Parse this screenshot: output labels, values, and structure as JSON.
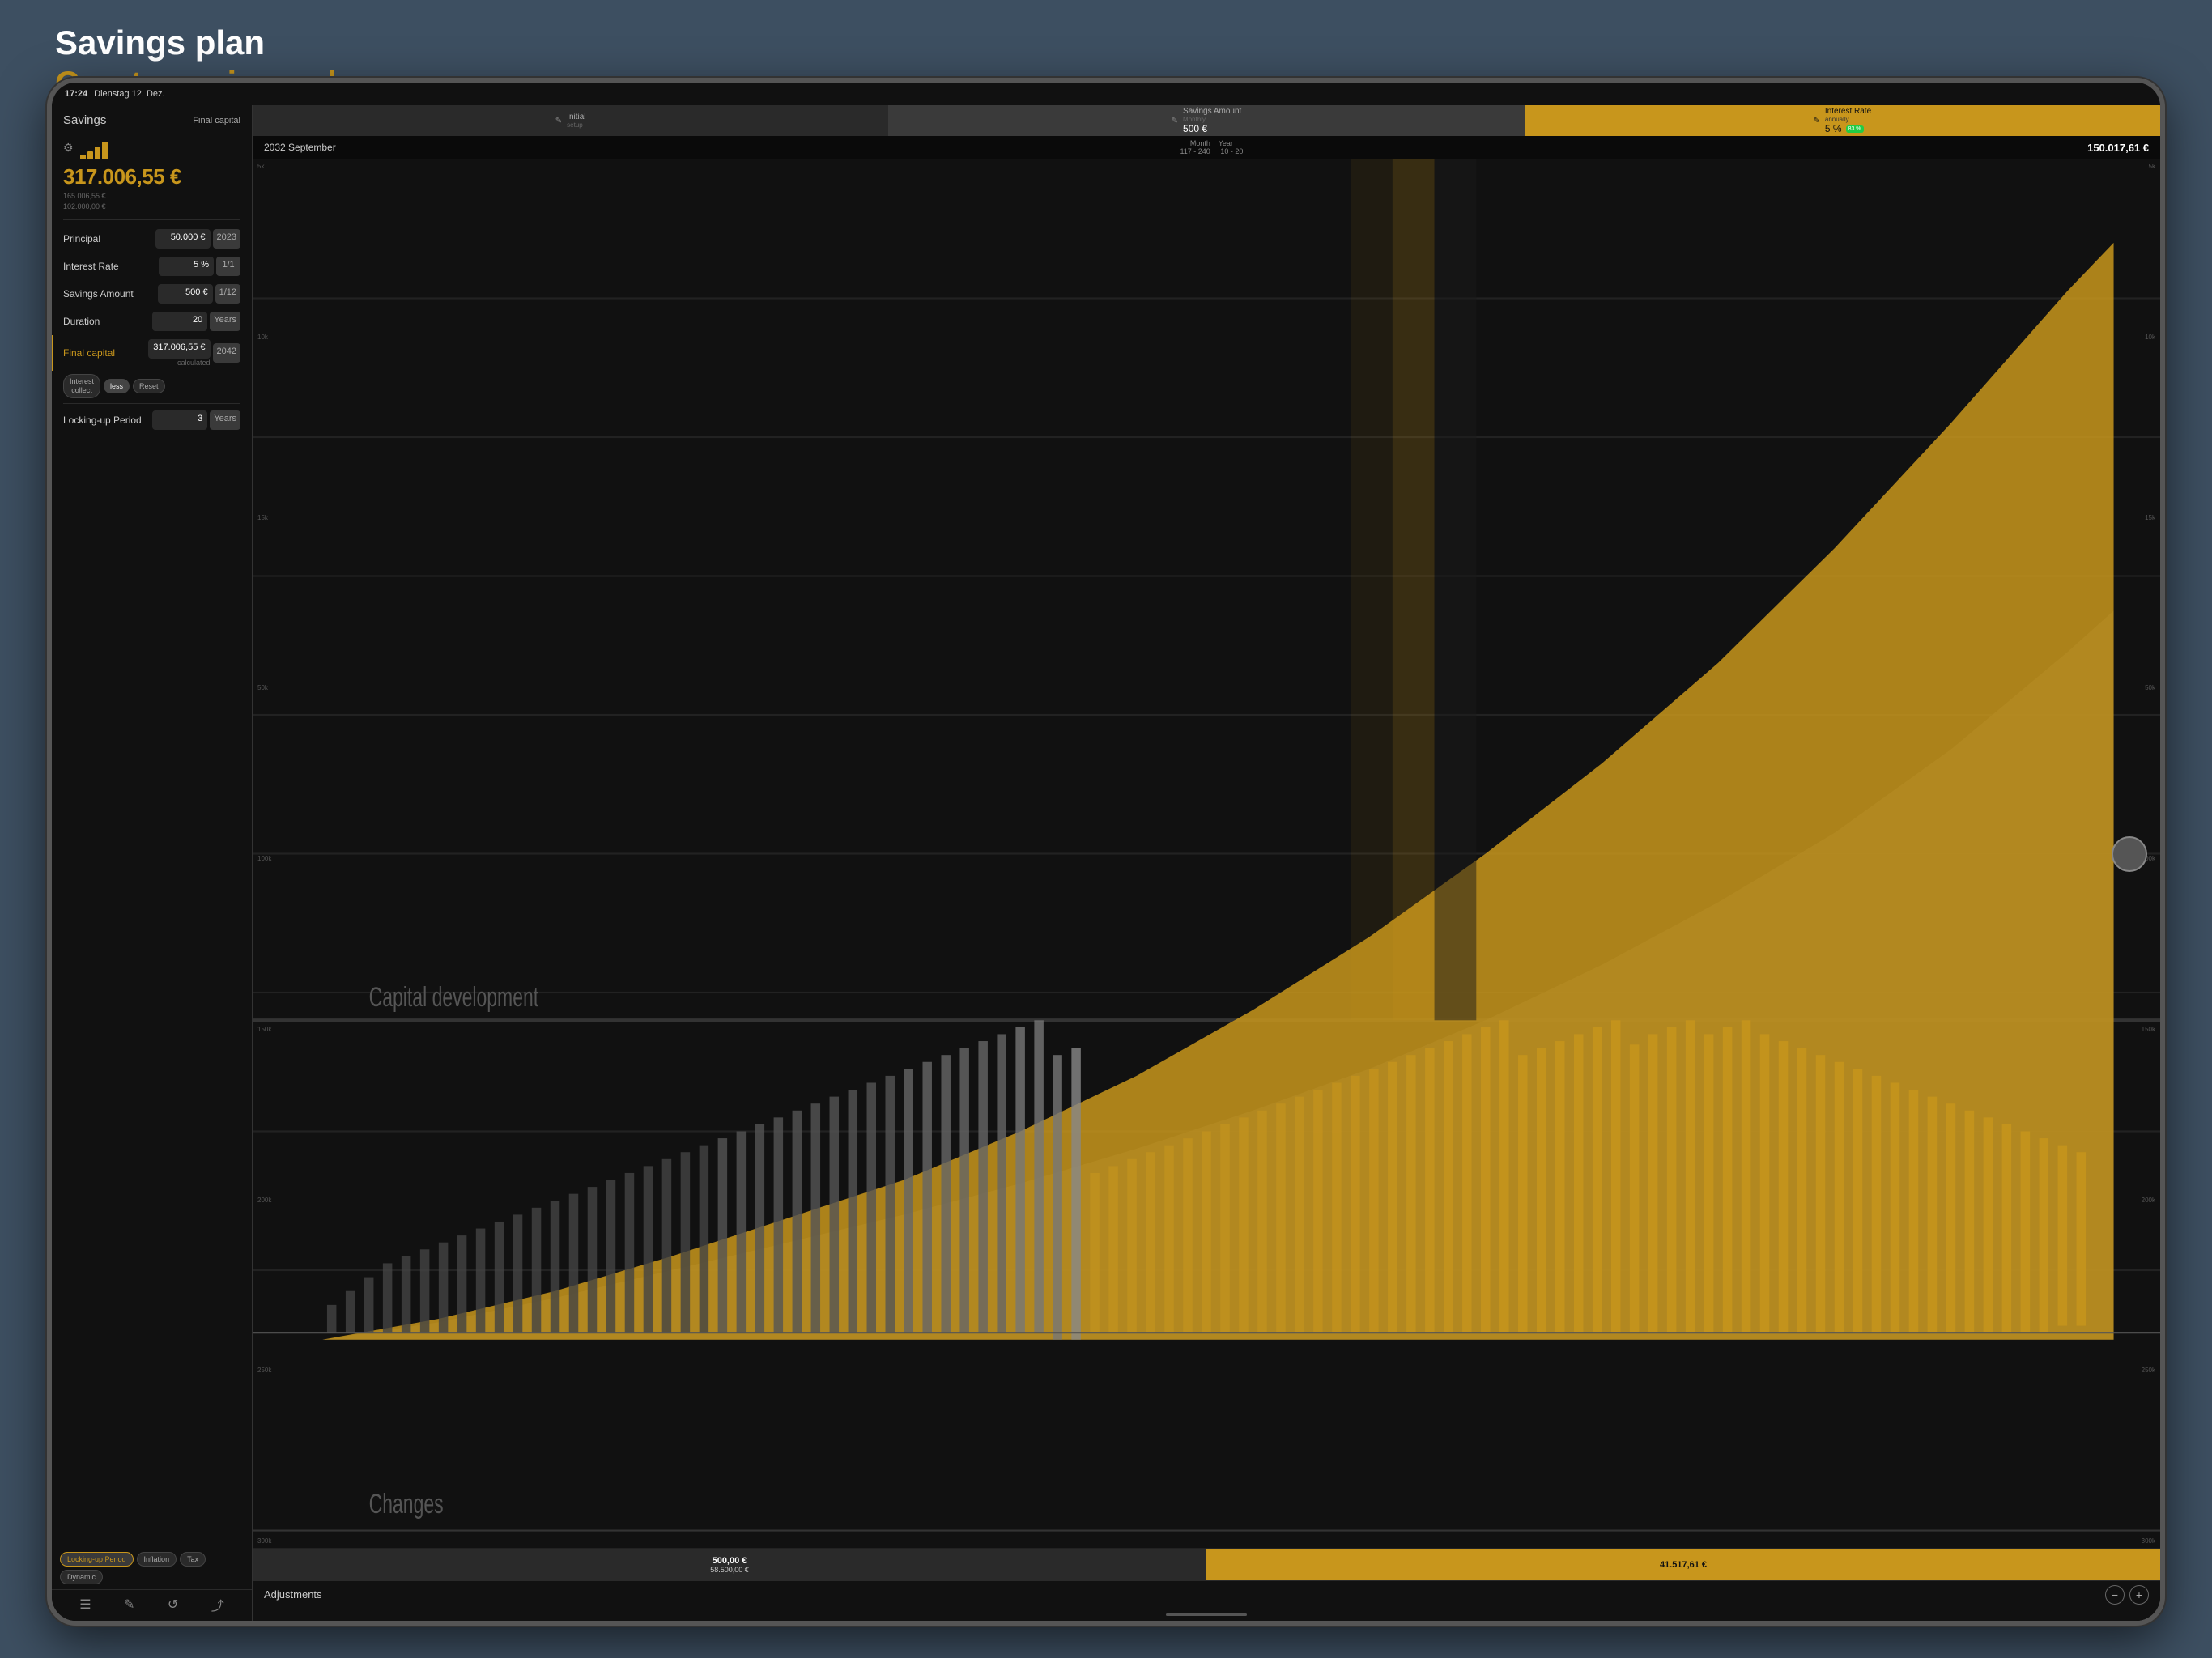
{
  "page": {
    "title_white": "Savings plan",
    "title_gold": "Create  savings plans",
    "background_color": "#3d4f61"
  },
  "status_bar": {
    "time": "17:24",
    "date": "Dienstag 12. Dez."
  },
  "left_panel": {
    "section_label": "Savings",
    "final_capital_label": "Final capital",
    "main_value": "317.006,55 €",
    "sub_value1": "165.006,55 €",
    "sub_value2": "102.000,00 €",
    "fields": [
      {
        "label": "Principal",
        "value": "50.000 €",
        "unit": "2023"
      },
      {
        "label": "Interest Rate",
        "value": "5 %",
        "unit": "1/1"
      },
      {
        "label": "Savings Amount",
        "value": "500 €",
        "unit": "1/12"
      },
      {
        "label": "Duration",
        "value": "20",
        "unit": "Years"
      }
    ],
    "final_capital_field": {
      "label": "Final capital",
      "value": "317.006,55 €",
      "sub": "calculated",
      "unit": "2042"
    },
    "buttons": [
      {
        "label": "Interest\ncollect",
        "active": false
      },
      {
        "label": "less",
        "active": true
      },
      {
        "label": "Reset",
        "active": false
      }
    ],
    "locking_period": {
      "label": "Locking-up Period",
      "value": "3",
      "unit": "Years"
    },
    "bottom_tabs": [
      {
        "label": "Locking-up Period",
        "active": true
      },
      {
        "label": "Inflation",
        "active": false
      },
      {
        "label": "Tax",
        "active": false
      },
      {
        "label": "Dynamic",
        "active": false
      }
    ],
    "toolbar_icons": [
      "menu",
      "edit",
      "refresh",
      "share"
    ]
  },
  "chart_header": {
    "tab1": {
      "label": "Initial\nsetup",
      "edit_icon": "✎"
    },
    "tab2": {
      "label": "Savings Amount",
      "sublabel": "Monthly",
      "value": "500 €",
      "edit_icon": "✎"
    },
    "tab3": {
      "label": "Interest Rate",
      "sublabel": "annually",
      "value": "5 %",
      "badge": "83 %",
      "edit_icon": "✎"
    }
  },
  "chart_info": {
    "date": "2032 September",
    "month_label": "Month",
    "year_label": "Year",
    "month_range": "117 - 240",
    "year_range": "10 - 20",
    "total_value": "150.017,61 €"
  },
  "chart": {
    "y_labels_left": [
      "300k",
      "250k",
      "200k",
      "150k",
      "100k",
      "50k",
      "15k",
      "10k",
      "5k"
    ],
    "y_labels_right": [
      "300k",
      "250k",
      "200k",
      "150k",
      "100k",
      "50k",
      "15k",
      "10k",
      "5k"
    ],
    "label_cap_dev": "Capital development",
    "label_changes": "Changes"
  },
  "summary_bar": {
    "left_top": "500,00 €",
    "left_bottom": "58.500,00 €",
    "right_value": "41.517,61 €"
  },
  "adjustments_bar": {
    "label": "Adjustments",
    "btn_minus": "−",
    "btn_plus": "+"
  }
}
